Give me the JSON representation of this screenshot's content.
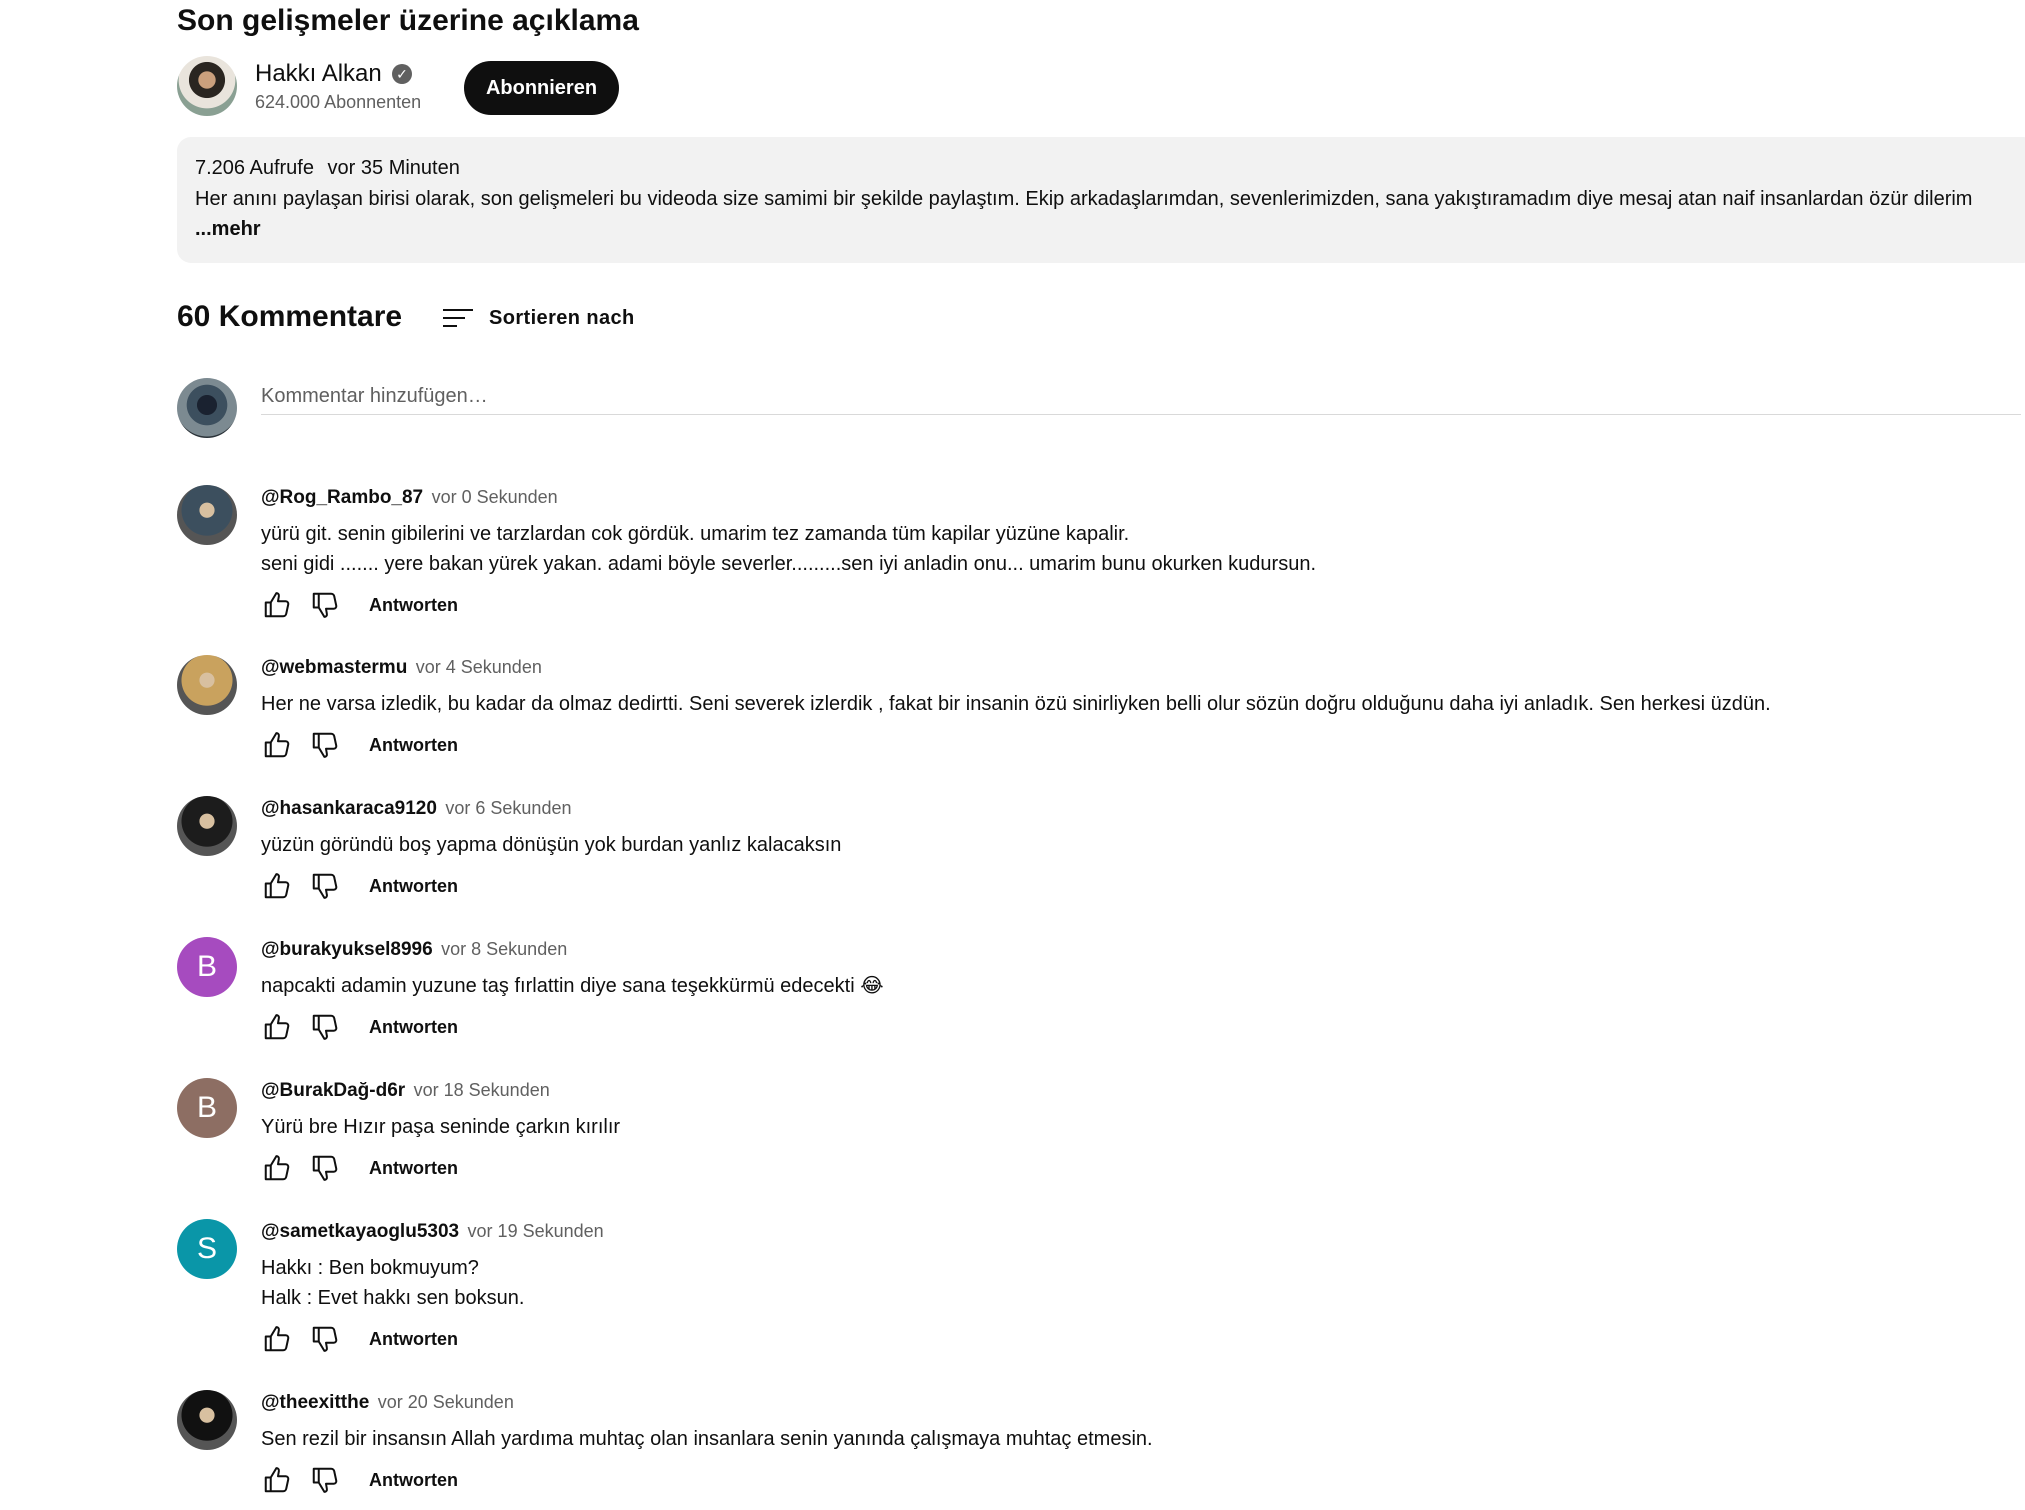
{
  "video": {
    "title": "Son gelişmeler üzerine açıklama"
  },
  "channel": {
    "name": "Hakkı Alkan",
    "subscribers": "624.000 Abonnenten",
    "subscribe_label": "Abonnieren"
  },
  "description": {
    "views": "7.206 Aufrufe",
    "age": "vor 35 Minuten",
    "text": "Her anını paylaşan birisi olarak, son gelişmeleri bu videoda size samimi bir şekilde paylaştım. Ekip arkadaşlarımdan, sevenlerimizden, sana yakıştıramadım diye mesaj atan naif insanlardan özür dilerim",
    "more_label": "...mehr"
  },
  "comments_section": {
    "count_label": "60 Kommentare",
    "sort_label": "Sortieren nach",
    "add_placeholder": "Kommentar hinzufügen…",
    "reply_label": "Antworten"
  },
  "comments": [
    {
      "author": "@Rog_Rambo_87",
      "time": "vor 0 Sekunden",
      "text": "yürü git. senin gibilerini ve tarzlardan cok gördük. umarim tez zamanda tüm kapilar yüzüne kapalir.\nseni gidi ....... yere bakan yürek yakan. adami böyle severler.........sen iyi anladin onu... umarim bunu okurken kudursun.",
      "avatar_letter": "",
      "avatar_color": "#3c4f5e"
    },
    {
      "author": "@webmastermu",
      "time": "vor 4 Sekunden",
      "text": "Her ne varsa izledik, bu kadar da olmaz dedirtti. Seni severek izlerdik , fakat bir insanin özü sinirliyken belli olur sözün doğru olduğunu daha iyi anladık. Sen herkesi üzdün.",
      "avatar_letter": "",
      "avatar_color": "#c9a25e"
    },
    {
      "author": "@hasankaraca9120",
      "time": "vor 6 Sekunden",
      "text": "yüzün göründü boş yapma dönüşün yok burdan yanlız kalacaksın",
      "avatar_letter": "",
      "avatar_color": "#1c1c1c"
    },
    {
      "author": "@burakyuksel8996",
      "time": "vor 8 Sekunden",
      "text": "napcakti adamin yuzune taş fırlattin diye sana teşekkürmü edecekti 😂",
      "avatar_letter": "B",
      "avatar_color": "#a64bbf"
    },
    {
      "author": "@BurakDağ-d6r",
      "time": "vor 18 Sekunden",
      "text": "Yürü bre Hızır paşa seninde çarkın kırılır",
      "avatar_letter": "B",
      "avatar_color": "#8d6e63"
    },
    {
      "author": "@sametkayaoglu5303",
      "time": "vor 19 Sekunden",
      "text": "Hakkı : Ben bokmuyum?\nHalk : Evet hakkı sen boksun.",
      "avatar_letter": "S",
      "avatar_color": "#0a96a8"
    },
    {
      "author": "@theexitthe",
      "time": "vor 20 Sekunden",
      "text": "Sen rezil bir insansın Allah yardıma muhtaç olan insanlara senin yanında çalışmaya muhtaç etmesin.",
      "avatar_letter": "",
      "avatar_color": "#111111"
    }
  ]
}
